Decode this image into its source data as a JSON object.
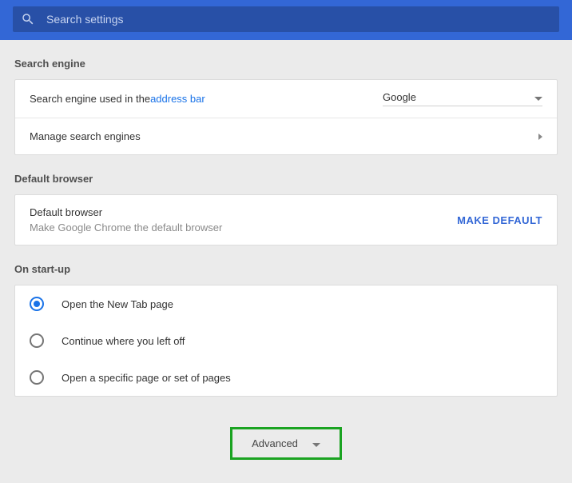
{
  "search": {
    "placeholder": "Search settings"
  },
  "sections": {
    "searchEngine": {
      "title": "Search engine",
      "row1_prefix": "Search engine used in the ",
      "row1_link": "address bar",
      "selected": "Google",
      "row2": "Manage search engines"
    },
    "defaultBrowser": {
      "title": "Default browser",
      "heading": "Default browser",
      "sub": "Make Google Chrome the default browser",
      "button": "MAKE DEFAULT"
    },
    "startup": {
      "title": "On start-up",
      "options": [
        "Open the New Tab page",
        "Continue where you left off",
        "Open a specific page or set of pages"
      ],
      "selectedIndex": 0
    }
  },
  "advanced": {
    "label": "Advanced"
  }
}
